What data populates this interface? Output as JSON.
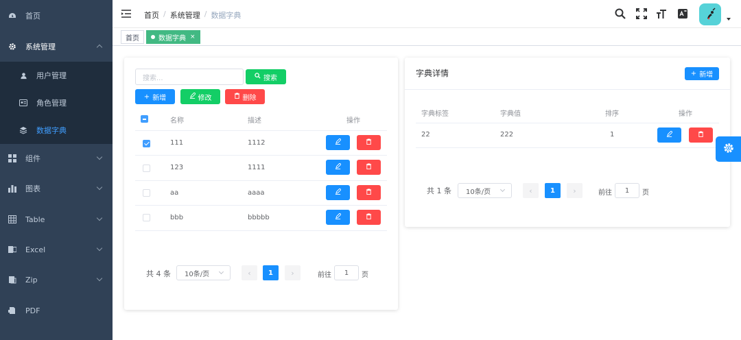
{
  "sidebar": {
    "items": [
      {
        "label": "首页",
        "icon": "dashboard-icon"
      },
      {
        "label": "系统管理",
        "icon": "gear-icon"
      },
      {
        "label": "组件",
        "icon": "grid-icon"
      },
      {
        "label": "图表",
        "icon": "bar-chart-icon"
      },
      {
        "label": "Table",
        "icon": "table-icon"
      },
      {
        "label": "Excel",
        "icon": "excel-icon"
      },
      {
        "label": "Zip",
        "icon": "zip-icon"
      },
      {
        "label": "PDF",
        "icon": "pdf-icon"
      }
    ],
    "sub_items": [
      {
        "label": "用户管理",
        "icon": "user-icon"
      },
      {
        "label": "角色管理",
        "icon": "id-card-icon"
      },
      {
        "label": "数据字典",
        "icon": "layers-icon"
      }
    ]
  },
  "breadcrumb": [
    "首页",
    "系统管理",
    "数据字典"
  ],
  "tags": [
    {
      "label": "首页"
    },
    {
      "label": "数据字典",
      "close": "×"
    }
  ],
  "dict": {
    "search_placeholder": "搜索...",
    "search_label": "搜索",
    "add_label": "新增",
    "edit_label": "修改",
    "delete_label": "删除",
    "columns": [
      "名称",
      "描述",
      "操作"
    ],
    "rows": [
      {
        "name": "111",
        "desc": "1112",
        "checked": true
      },
      {
        "name": "123",
        "desc": "1111",
        "checked": false
      },
      {
        "name": "aa",
        "desc": "aaaa",
        "checked": false
      },
      {
        "name": "bbb",
        "desc": "bbbbb",
        "checked": false
      }
    ],
    "pagination": {
      "total": "共 4 条",
      "size": "10条/页",
      "prev": "‹",
      "page": "1",
      "next": "›",
      "goto": "前往",
      "goto_value": "1",
      "page_suffix": "页"
    }
  },
  "detail": {
    "title": "字典详情",
    "add_label": "新增",
    "columns": [
      "字典标签",
      "字典值",
      "排序",
      "操作"
    ],
    "rows": [
      {
        "label": "22",
        "value": "222",
        "sort": "1"
      }
    ],
    "pagination": {
      "total": "共 1 条",
      "size": "10条/页",
      "prev": "‹",
      "page": "1",
      "next": "›",
      "goto": "前往",
      "goto_value": "1",
      "page_suffix": "页"
    }
  },
  "colors": {
    "sidebar_bg": "#304156",
    "primary": "#1890ff",
    "success": "#13ce66",
    "danger": "#ff4949",
    "tag_active": "#42b983"
  }
}
